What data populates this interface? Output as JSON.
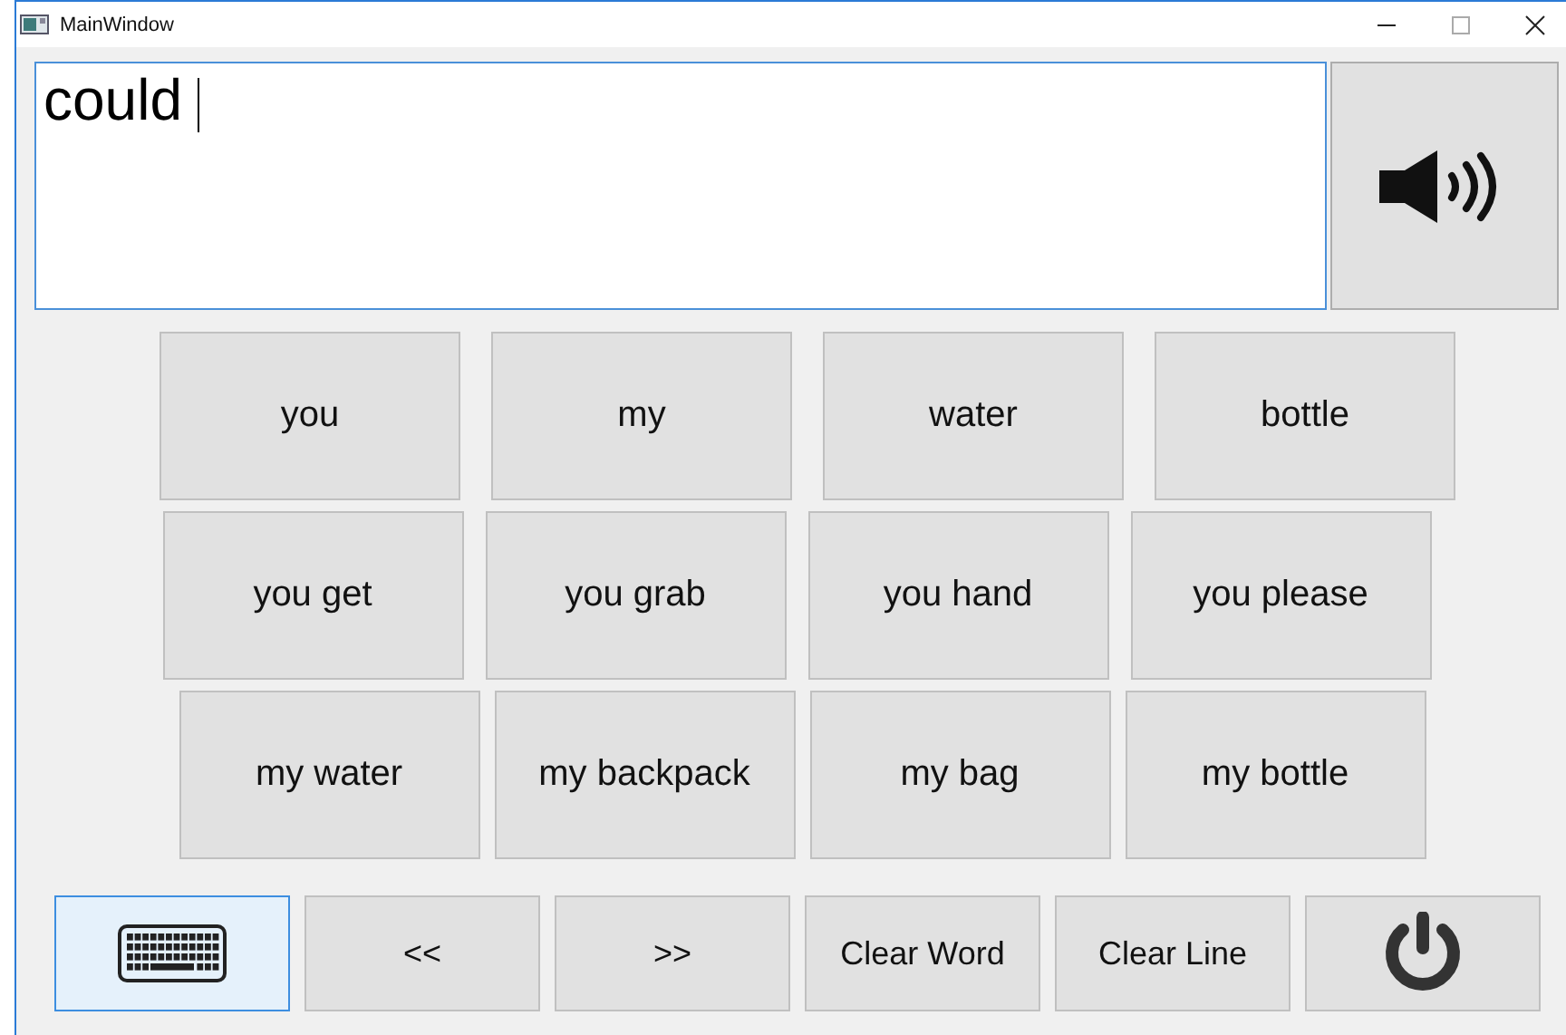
{
  "window": {
    "title": "MainWindow"
  },
  "text_field": {
    "value": "could "
  },
  "word_rows": [
    [
      "you",
      "my",
      "water",
      "bottle"
    ],
    [
      "you get",
      "you grab",
      "you hand",
      "you please"
    ],
    [
      "my water",
      "my backpack",
      "my bag",
      "my bottle"
    ]
  ],
  "bottom_buttons": [
    {
      "kind": "keyboard",
      "selected": true
    },
    {
      "kind": "text",
      "label": "<<",
      "selected": false
    },
    {
      "kind": "text",
      "label": ">>",
      "selected": false
    },
    {
      "kind": "text",
      "label": "Clear Word",
      "selected": false
    },
    {
      "kind": "text",
      "label": "Clear Line",
      "selected": false
    },
    {
      "kind": "power",
      "selected": false
    }
  ]
}
